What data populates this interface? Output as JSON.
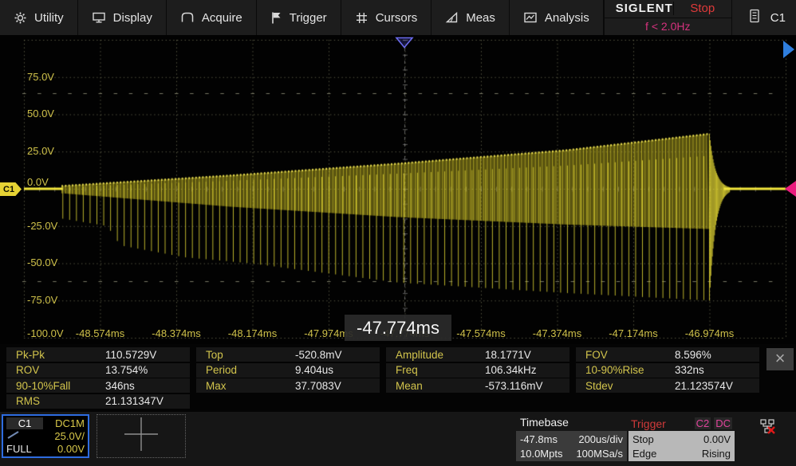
{
  "menu": {
    "items": [
      {
        "label": "Utility",
        "icon": "gear-icon"
      },
      {
        "label": "Display",
        "icon": "display-icon"
      },
      {
        "label": "Acquire",
        "icon": "acquire-icon"
      },
      {
        "label": "Trigger",
        "icon": "flag-icon"
      },
      {
        "label": "Cursors",
        "icon": "cursors-icon"
      },
      {
        "label": "Meas",
        "icon": "meas-icon"
      },
      {
        "label": "Analysis",
        "icon": "analysis-icon"
      }
    ],
    "brand": "SIGLENT",
    "acq_status": "Stop",
    "trig_freq": "f < 2.0Hz",
    "channel_badge": "C1"
  },
  "plot": {
    "v_labels": [
      "75.0V",
      "50.0V",
      "25.0V",
      "0.0V",
      "-25.0V",
      "-50.0V",
      "-75.0V",
      "-100.0V"
    ],
    "t_labels": [
      "-48.574ms",
      "-48.374ms",
      "-48.174ms",
      "-47.974ms",
      "-47.774ms",
      "-47.574ms",
      "-47.374ms",
      "-47.174ms",
      "-46.974ms"
    ],
    "delay_popup": "-47.774ms",
    "channel_marker": "C1",
    "colors": {
      "trace": "#f0e232",
      "trigger_level": "#ea1c7e",
      "trigger_pos": "#6b6bec",
      "offscreen_arrow": "#2f7fdf",
      "grid": "#7d7d5f"
    }
  },
  "waveform": {
    "type": "amplitude-sweep-burst",
    "volts_per_div": 25,
    "time_per_div": "200us/div",
    "baseline_v": 0,
    "burst_span_frac": [
      0.05,
      0.9
    ],
    "top_env_v": [
      [
        0,
        2
      ],
      [
        0.26,
        9
      ],
      [
        0.52,
        17
      ],
      [
        0.78,
        26
      ],
      [
        1,
        37
      ]
    ],
    "dense_bot_v": [
      [
        0,
        -3
      ],
      [
        0.26,
        -12
      ],
      [
        0.52,
        -19
      ],
      [
        0.78,
        -24
      ],
      [
        1,
        -27
      ]
    ],
    "spike_bot_v": [
      [
        0,
        -20
      ],
      [
        0.07,
        -25
      ],
      [
        0.09,
        -38
      ],
      [
        0.19,
        -46
      ],
      [
        0.29,
        -50
      ],
      [
        0.52,
        -63
      ],
      [
        0.78,
        -70
      ],
      [
        1,
        -75
      ]
    ]
  },
  "measurements": {
    "cells": [
      {
        "label": "Pk-Pk",
        "value": "110.5729V"
      },
      {
        "label": "Top",
        "value": "-520.8mV"
      },
      {
        "label": "Amplitude",
        "value": "18.1771V"
      },
      {
        "label": "FOV",
        "value": "8.596%"
      },
      {
        "label": "ROV",
        "value": "13.754%"
      },
      {
        "label": "Period",
        "value": "9.404us"
      },
      {
        "label": "Freq",
        "value": "106.34kHz"
      },
      {
        "label": "10-90%Rise",
        "value": "332ns"
      },
      {
        "label": "90-10%Fall",
        "value": "346ns"
      },
      {
        "label": "Max",
        "value": "37.7083V"
      },
      {
        "label": "Mean",
        "value": "-573.116mV"
      },
      {
        "label": "Stdev",
        "value": "21.123574V"
      },
      {
        "label": "RMS",
        "value": "21.131347V"
      }
    ],
    "close_glyph": "×"
  },
  "channel_panel": {
    "name": "C1",
    "coupling": "DC1M",
    "scale": "25.0V/",
    "bandwidth": "FULL",
    "offset": "0.00V"
  },
  "timebase_panel": {
    "title": "Timebase",
    "delay": "-47.8ms",
    "scale": "200us/div",
    "memory": "10.0Mpts",
    "sample_rate": "100MSa/s"
  },
  "trigger_panel": {
    "title": "Trigger",
    "source": "C2",
    "coupling": "DC",
    "mode": "Stop",
    "level": "0.00V",
    "type": "Edge",
    "slope": "Rising"
  }
}
